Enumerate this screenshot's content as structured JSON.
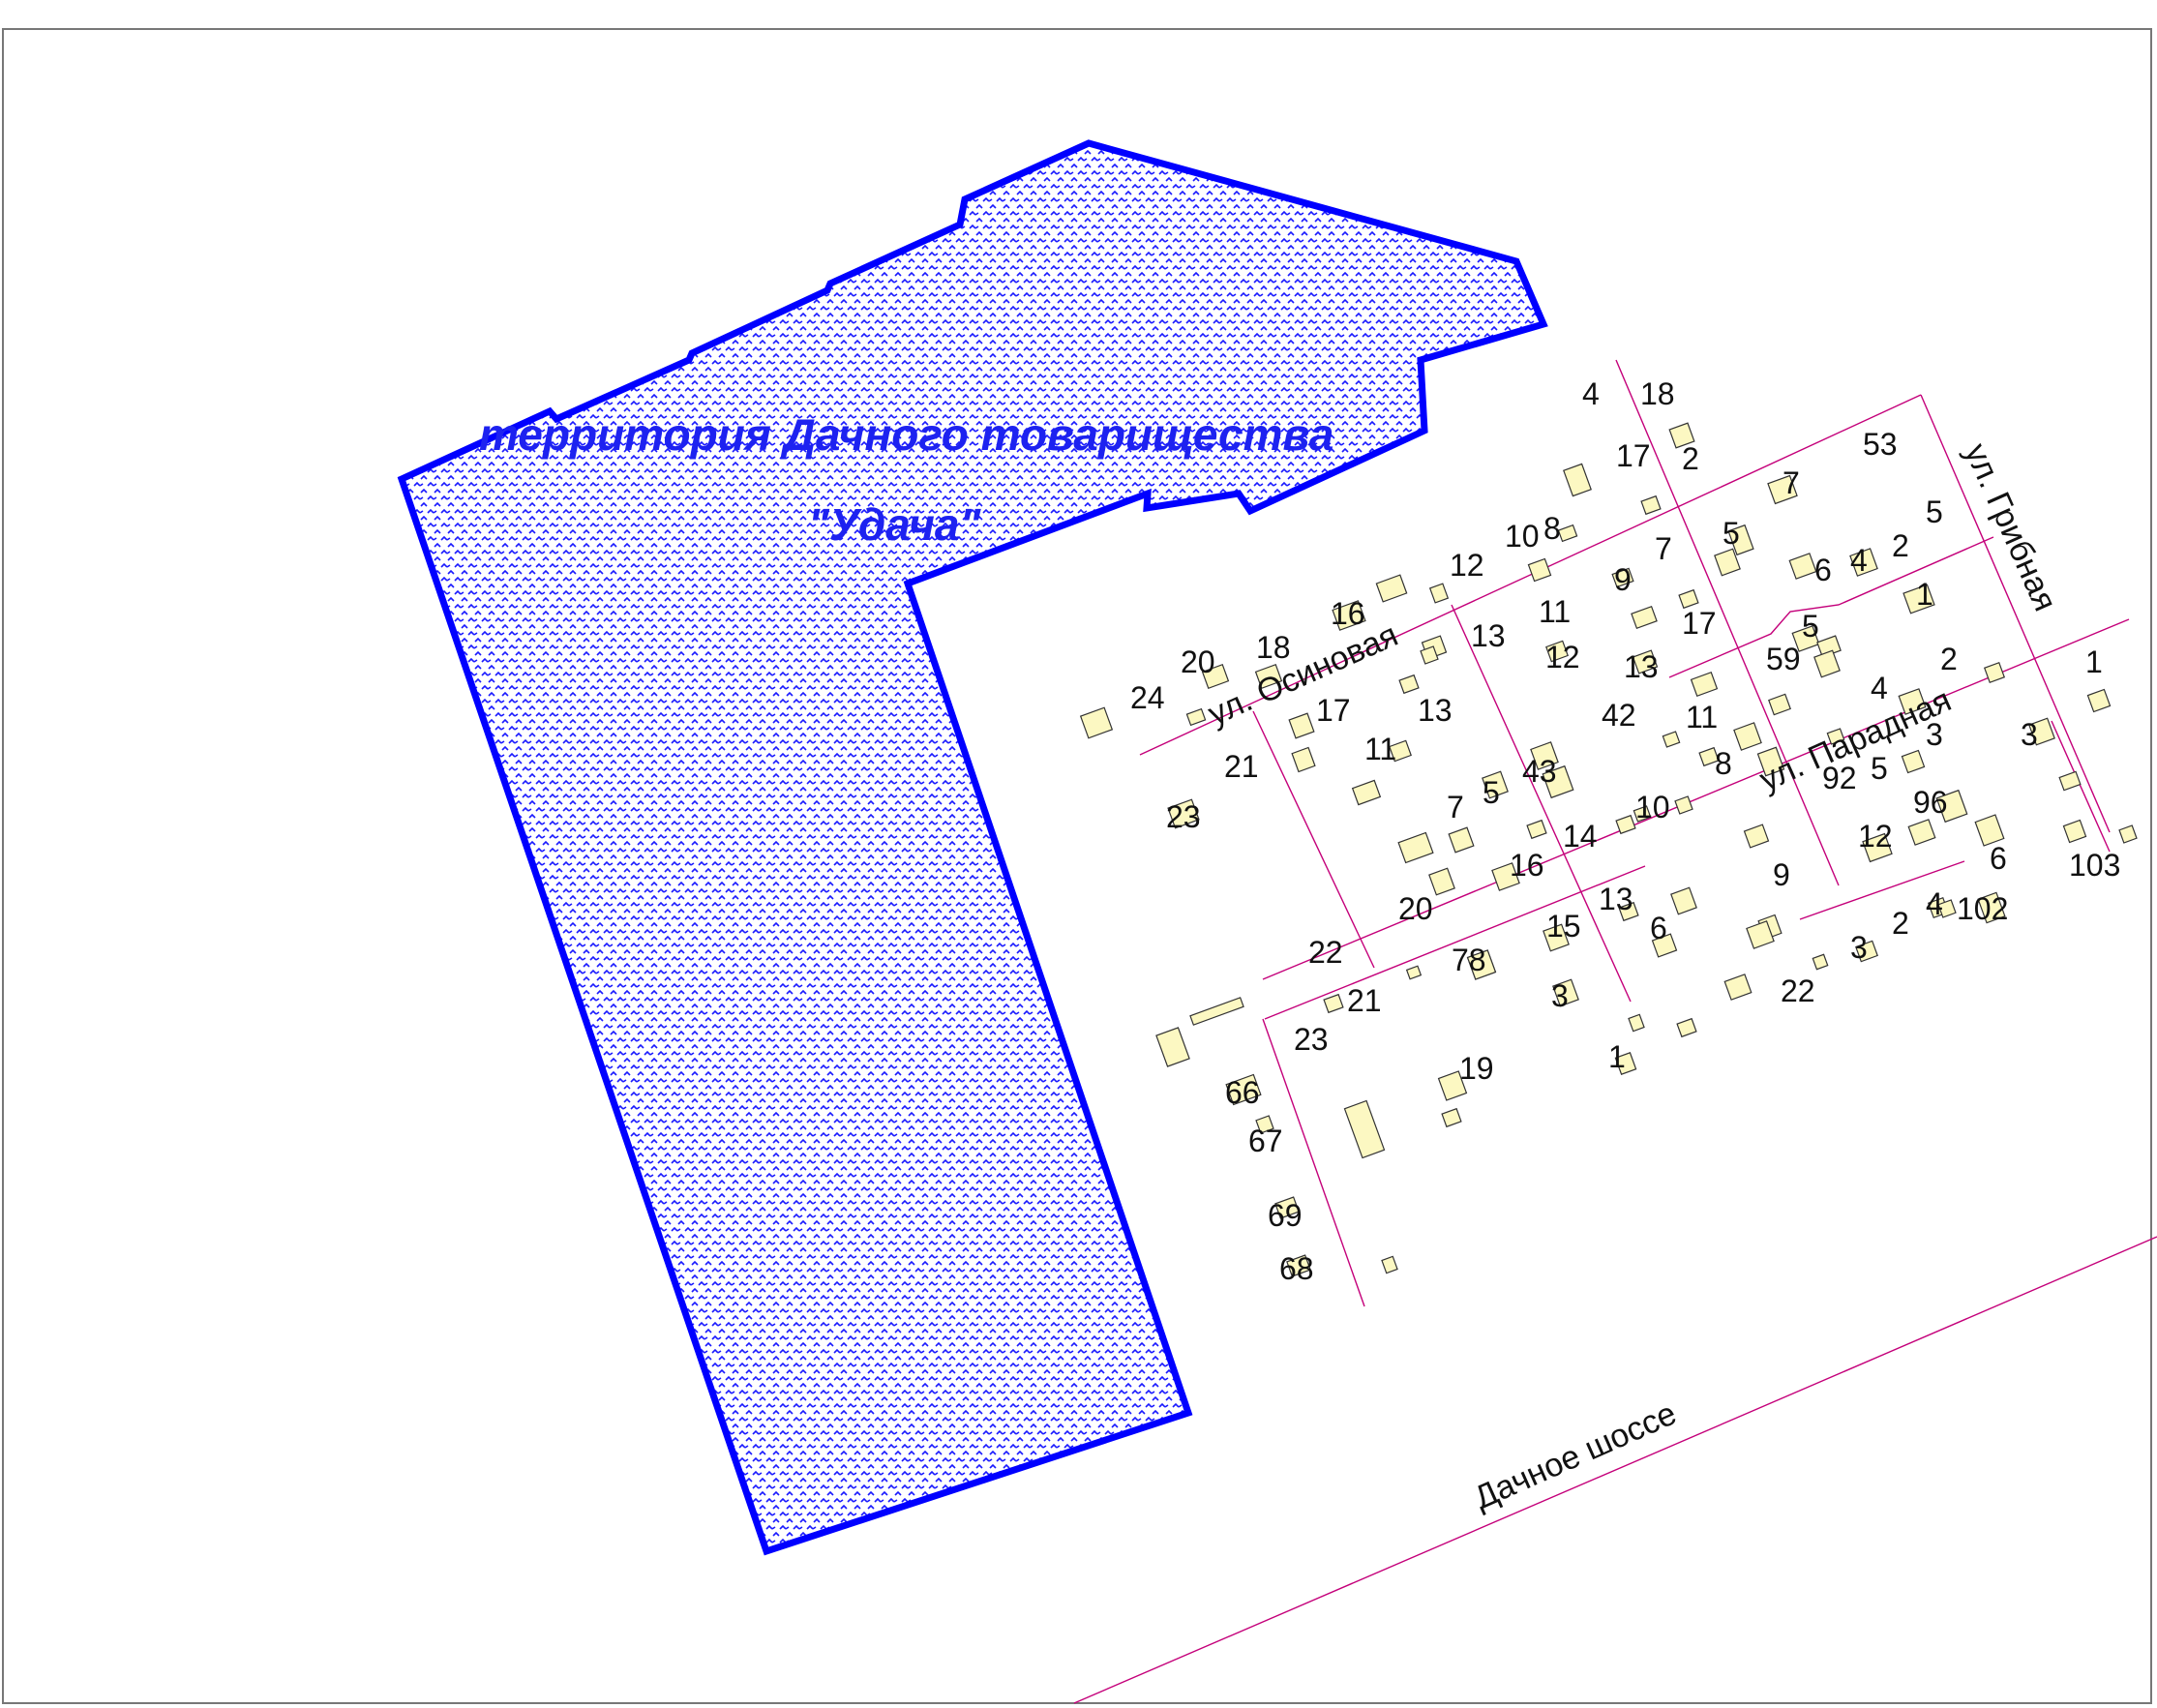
{
  "territory": {
    "title_line1": "территория Дачного товарищества",
    "title_line2": "\"Удача\"",
    "fill_color": "#1a1aff",
    "border_color": "#0000ff"
  },
  "streets": {
    "osinovaya": "ул. Осиновая",
    "paradnaya": "ул. Парадная",
    "gribnaya": "ул. Грибная",
    "dachnoe_shosse": "Дачное шоссе"
  },
  "colors": {
    "road": "#c4007a",
    "building_fill": "#fcf8c2"
  },
  "house_numbers": [
    "4",
    "18",
    "17",
    "2",
    "53",
    "7",
    "5",
    "5",
    "10",
    "8",
    "12",
    "7",
    "9",
    "6",
    "4",
    "2",
    "1",
    "16",
    "11",
    "17",
    "13",
    "5",
    "20",
    "18",
    "59",
    "2",
    "12",
    "13",
    "4",
    "24",
    "17",
    "13",
    "42",
    "11",
    "1",
    "21",
    "11",
    "8",
    "92",
    "5",
    "3",
    "3",
    "23",
    "7",
    "5",
    "43",
    "96",
    "14",
    "10",
    "12",
    "16",
    "9",
    "6",
    "103",
    "20",
    "13",
    "102",
    "15",
    "6",
    "4",
    "22",
    "78",
    "2",
    "3",
    "3",
    "21",
    "22",
    "23",
    "19",
    "1",
    "66",
    "67",
    "69",
    "68"
  ]
}
